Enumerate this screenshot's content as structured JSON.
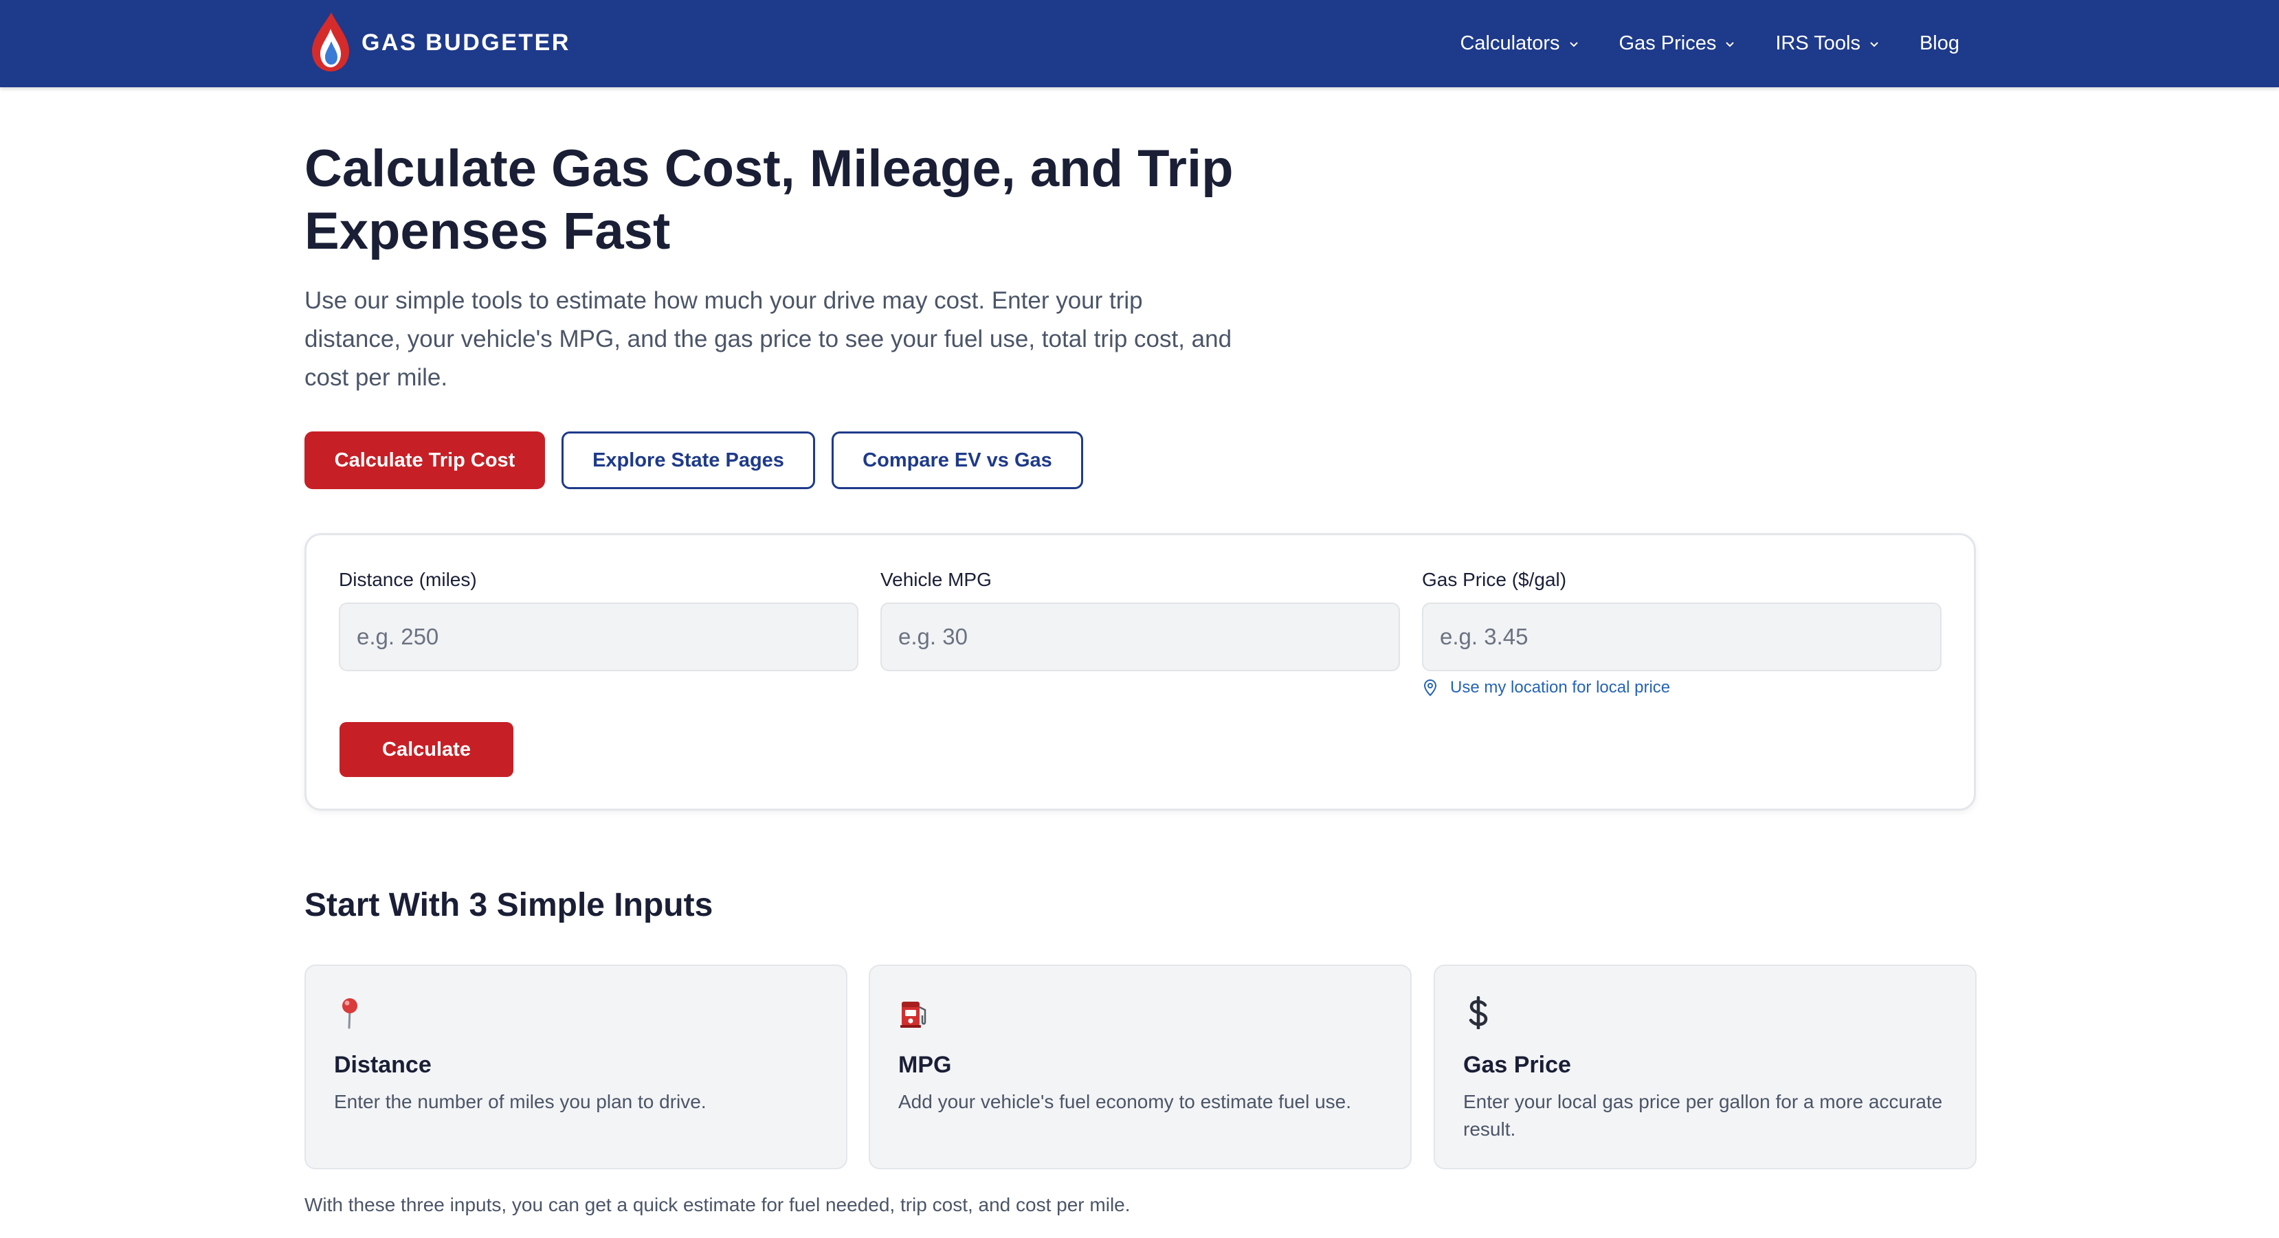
{
  "header": {
    "brand_name": "GAS BUDGETER",
    "nav": [
      {
        "label": "Calculators",
        "has_dropdown": true
      },
      {
        "label": "Gas Prices",
        "has_dropdown": true
      },
      {
        "label": "IRS Tools",
        "has_dropdown": true
      },
      {
        "label": "Blog",
        "has_dropdown": false
      }
    ]
  },
  "hero": {
    "title": "Calculate Gas Cost, Mileage, and Trip Expenses Fast",
    "subtitle": "Use our simple tools to estimate how much your drive may cost. Enter your trip distance, your vehicle's MPG, and the gas price to see your fuel use, total trip cost, and cost per mile.",
    "buttons": {
      "primary": "Calculate Trip Cost",
      "states": "Explore State Pages",
      "ev": "Compare EV vs Gas"
    }
  },
  "calculator": {
    "fields": [
      {
        "label": "Distance (miles)",
        "placeholder": "e.g. 250",
        "value": ""
      },
      {
        "label": "Vehicle MPG",
        "placeholder": "e.g. 30",
        "value": ""
      },
      {
        "label": "Gas Price ($/gal)",
        "placeholder": "e.g. 3.45",
        "value": ""
      }
    ],
    "location_link": "Use my location for local price",
    "submit_label": "Calculate"
  },
  "inputs_section": {
    "title": "Start With 3 Simple Inputs",
    "cards": [
      {
        "icon": "map-pin-icon",
        "title": "Distance",
        "text": "Enter the number of miles you plan to drive."
      },
      {
        "icon": "fuel-pump-icon",
        "title": "MPG",
        "text": "Add your vehicle's fuel economy to estimate fuel use."
      },
      {
        "icon": "dollar-sign-icon",
        "title": "Gas Price",
        "text": "Enter your local gas price per gallon for a more accurate result."
      }
    ],
    "footnote": "With these three inputs, you can get a quick estimate for fuel needed, trip cost, and cost per mile."
  },
  "colors": {
    "header_bg": "#1e3a8a",
    "accent_red": "#c62026",
    "link_blue": "#2563b8",
    "card_bg": "#f3f4f6"
  }
}
